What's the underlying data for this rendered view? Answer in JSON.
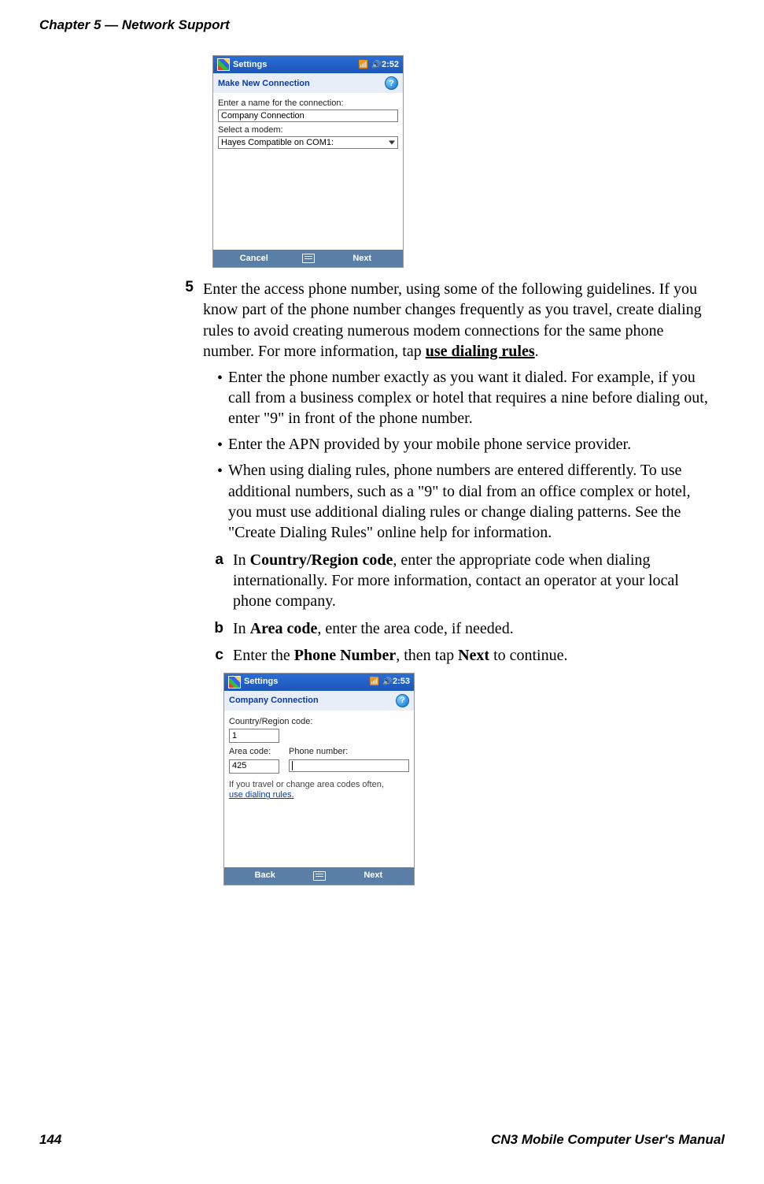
{
  "header": {
    "running": "Chapter 5 — Network Support"
  },
  "footer": {
    "page": "144",
    "manual": "CN3 Mobile Computer User's Manual"
  },
  "shot1": {
    "appTitle": "Settings",
    "time": "2:52",
    "subtitle": "Make New Connection",
    "help": "?",
    "label1": "Enter a name for the connection:",
    "value1": "Company Connection",
    "label2": "Select a modem:",
    "value2": "Hayes Compatible on COM1:",
    "menuLeft": "Cancel",
    "menuRight": "Next"
  },
  "shot2": {
    "appTitle": "Settings",
    "time": "2:53",
    "subtitle": "Company Connection",
    "help": "?",
    "labelCountry": "Country/Region code:",
    "valueCountry": "1",
    "labelArea": "Area code:",
    "valueArea": "425",
    "labelPhone": "Phone number:",
    "hintPre": "If you travel or change area codes often,",
    "hintLink": "use dialing rules.",
    "menuLeft": "Back",
    "menuRight": "Next"
  },
  "step5": {
    "marker": "5",
    "textA": "Enter the access phone number, using some of the following guidelines. If you know part of the phone number changes frequently as you travel, create dialing rules to avoid creating numerous modem connections for the same phone number. For more information, tap ",
    "textLink": "use dialing rules",
    "textEnd": ".",
    "b1": "Enter the phone number exactly as you want it dialed. For example, if you call from a business complex or hotel that requires a nine before dialing out, enter \"9\" in front of the phone number.",
    "b2": "Enter the APN provided by your mobile phone service provider.",
    "b3": "When using dialing rules, phone numbers are entered differently. To use additional numbers, such as a \"9\" to dial from an office complex or hotel, you must use additional dialing rules or change dialing patterns. See the \"Create Dialing Rules\" online help for information."
  },
  "subA": {
    "marker": "a",
    "pre": "In ",
    "bold": "Country/Region code",
    "post": ", enter the appropriate code when dialing internationally. For more information, contact an operator at your local phone company."
  },
  "subB": {
    "marker": "b",
    "pre": "In ",
    "bold": "Area code",
    "post": ", enter the area code, if needed."
  },
  "subC": {
    "marker": "c",
    "pre": "Enter the ",
    "bold1": "Phone Number",
    "mid": ", then tap ",
    "bold2": "Next",
    "post": " to continue."
  }
}
